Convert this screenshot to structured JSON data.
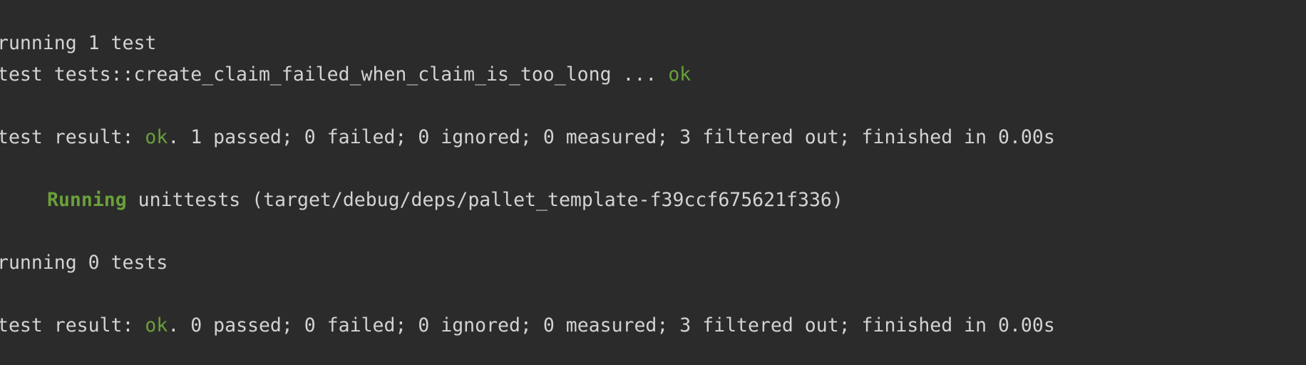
{
  "terminal": {
    "lines": [
      {
        "text": "running 1 test"
      },
      {
        "prefix": "test tests::create_claim_failed_when_claim_is_too_long ... ",
        "status": "ok"
      },
      {
        "prefix": "test result: ",
        "status": "ok",
        "suffix": ". 1 passed; 0 failed; 0 ignored; 0 measured; 3 filtered out; finished in 0.00s"
      },
      {
        "label": "Running",
        "suffix": " unittests (target/debug/deps/pallet_template-f39ccf675621f336)"
      },
      {
        "text": "running 0 tests"
      },
      {
        "prefix": "test result: ",
        "status": "ok",
        "suffix": ". 0 passed; 0 failed; 0 ignored; 0 measured; 3 filtered out; finished in 0.00s"
      }
    ]
  },
  "colors": {
    "background": "#2b2b2b",
    "text": "#d3d3d3",
    "ok": "#6a9f3a"
  }
}
